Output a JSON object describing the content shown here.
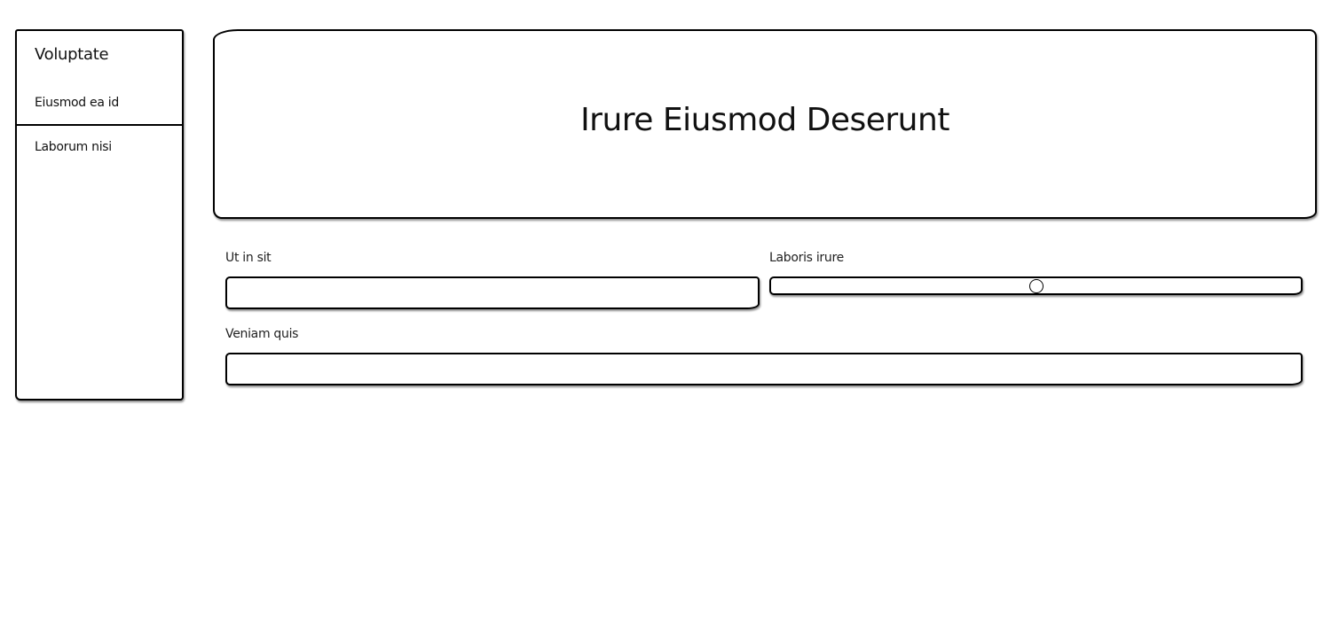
{
  "sidebar": {
    "title": "Voluptate",
    "items": [
      {
        "label": "Eiusmod ea id"
      },
      {
        "label": "Laborum nisi"
      }
    ]
  },
  "header": {
    "title": "Irure Eiusmod Deserunt"
  },
  "form": {
    "field_1": {
      "label": "Ut in sit",
      "value": "",
      "placeholder": ""
    },
    "slider": {
      "label": "Laboris irure",
      "value": 0.5
    },
    "field_3": {
      "label": "Veniam quis",
      "value": "",
      "placeholder": ""
    }
  },
  "colors": {
    "border": "#000000",
    "background": "#ffffff",
    "text": "#111111"
  }
}
